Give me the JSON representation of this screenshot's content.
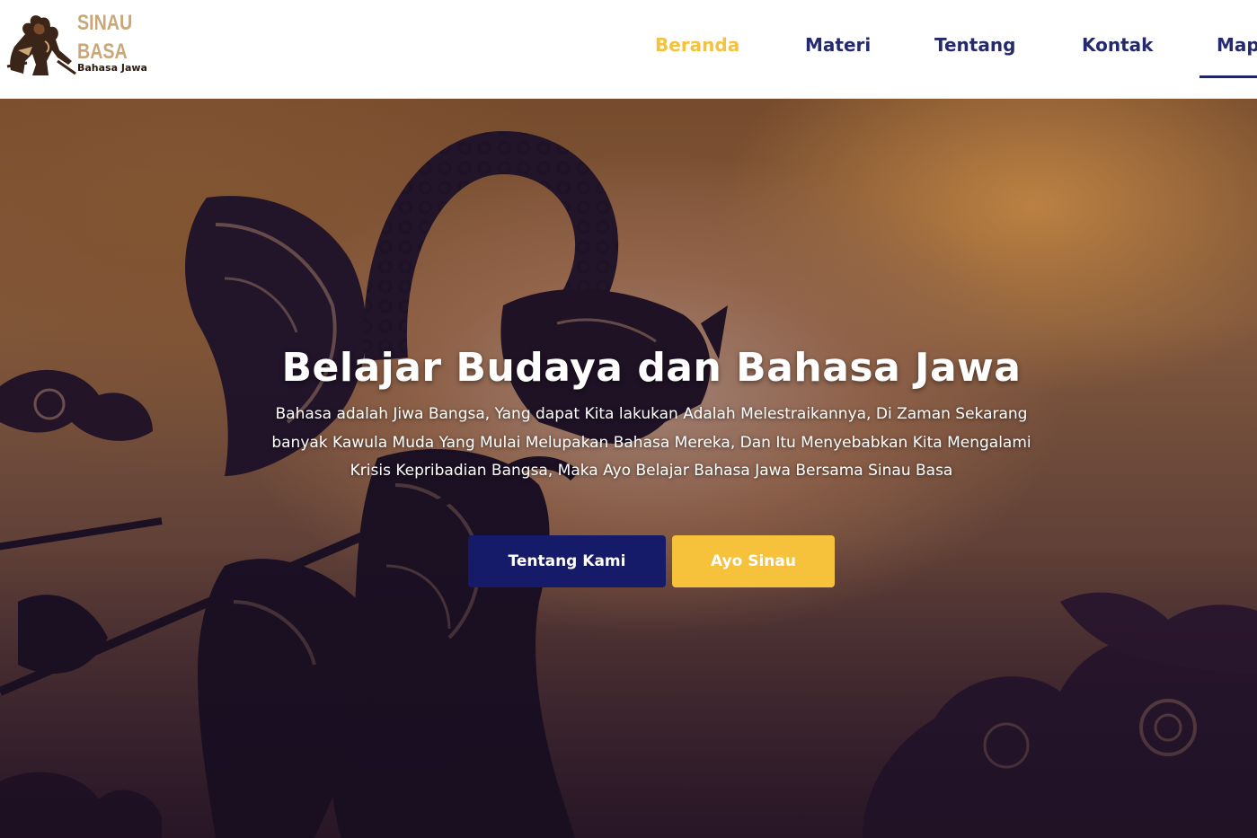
{
  "brand": {
    "line1": "SINAU",
    "line2": "BASA",
    "tagline": "Bahasa Jawa",
    "color": "#c9a779"
  },
  "nav": {
    "items": [
      {
        "label": "Beranda",
        "active": true
      },
      {
        "label": "Materi",
        "active": false
      },
      {
        "label": "Tentang",
        "active": false
      },
      {
        "label": "Kontak",
        "active": false
      },
      {
        "label": "Map",
        "active": false
      }
    ],
    "active_color": "#f6c23c",
    "color": "#252a6e"
  },
  "hero": {
    "title": "Belajar Budaya dan Bahasa Jawa",
    "description": "Bahasa adalah Jiwa Bangsa, Yang dapat Kita lakukan Adalah Melestraikannya, Di Zaman Sekarang banyak Kawula Muda Yang Mulai Melupakan Bahasa Mereka, Dan Itu Menyebabkan Kita Mengalami Krisis Kepribadian Bangsa, Maka Ayo Belajar Bahasa Jawa Bersama Sinau Basa",
    "buttons": {
      "primary": "Tentang Kami",
      "secondary": "Ayo Sinau"
    },
    "background_icon": "wayang-shadow-puppet-illustration"
  },
  "colors": {
    "primary_button": "#161b69",
    "accent": "#f6c23c"
  }
}
